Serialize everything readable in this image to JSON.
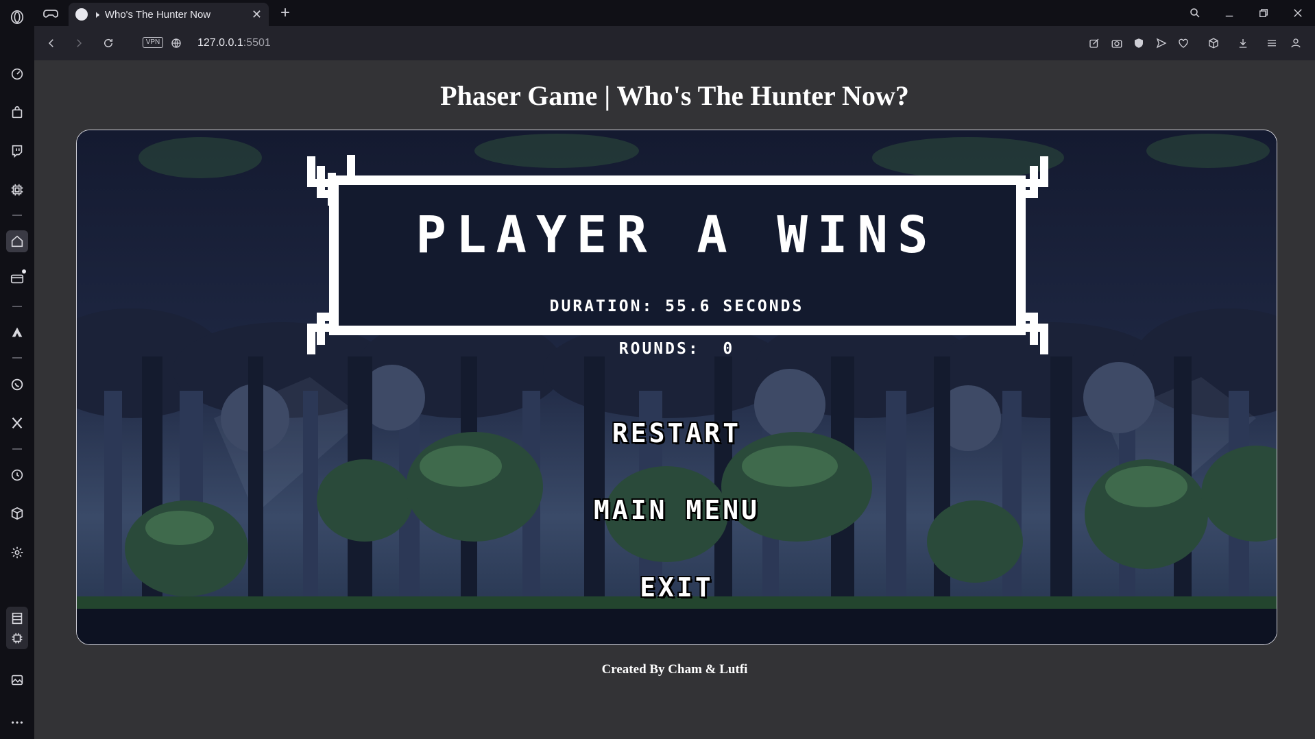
{
  "browser": {
    "tab_title": "Who's The Hunter Now",
    "url_host": "127.0.0.1",
    "url_port": ":5501",
    "vpn_label": "VPN"
  },
  "page": {
    "title": "Phaser Game | Who's The Hunter Now?",
    "credits": "Created By Cham & Lutfi"
  },
  "game": {
    "result_title": "PLAYER A WINS",
    "duration": "DURATION: 55.6 SECONDS",
    "rounds_label": "ROUNDS:",
    "rounds_value": "0",
    "buttons": {
      "restart": "RESTART",
      "main_menu": "MAIN MENU",
      "exit": "EXIT"
    }
  },
  "colors": {
    "page_bg": "#333336",
    "browser_chrome": "#101016",
    "forest_dark": "#1a2038",
    "frame_white": "#ffffff"
  }
}
